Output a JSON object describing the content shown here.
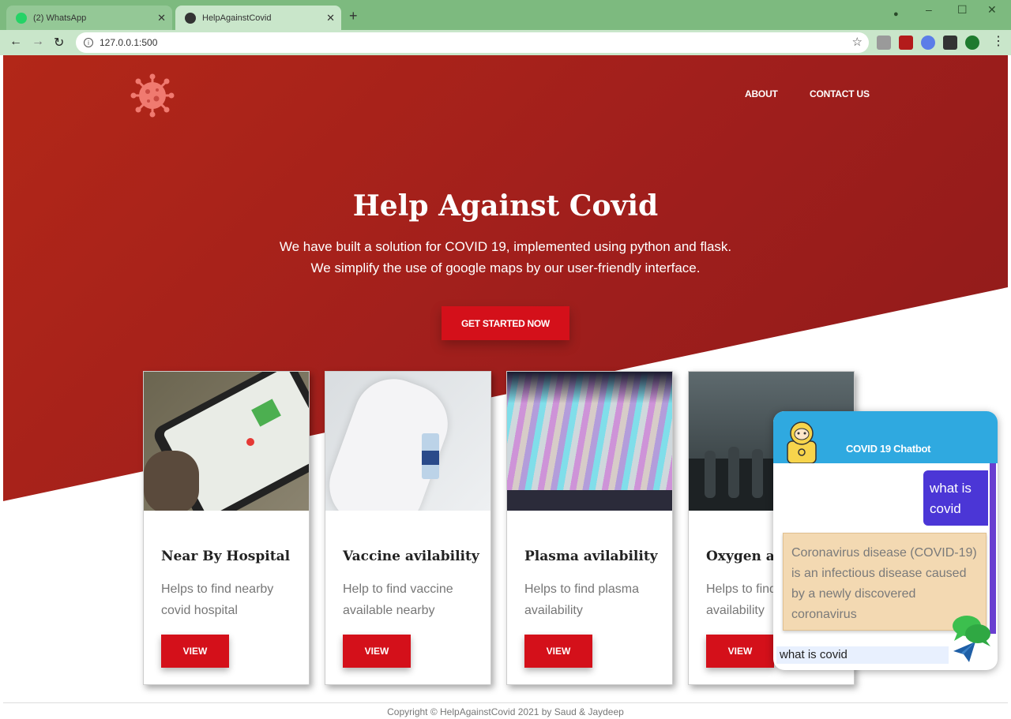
{
  "browser": {
    "tabs": [
      {
        "label": "(2) WhatsApp",
        "active": false
      },
      {
        "label": "HelpAgainstCovid",
        "active": true
      }
    ],
    "url": "127.0.0.1:500"
  },
  "nav": {
    "items": [
      "ABOUT",
      "CONTACT US"
    ]
  },
  "hero": {
    "title": "Help Against Covid",
    "line1": "We have built a solution for COVID 19, implemented using python and flask.",
    "line2": "We simplify the use of google maps by our user-friendly interface.",
    "cta": "GET STARTED NOW"
  },
  "cards": [
    {
      "title": "Near By Hospital",
      "desc": "Helps to find nearby covid hospital",
      "button": "VIEW",
      "image": "phone-map"
    },
    {
      "title": "Vaccine avilability",
      "desc": "Help to find vaccine available nearby",
      "button": "VIEW",
      "image": "vaccine-vial"
    },
    {
      "title": "Plasma avilability",
      "desc": "Helps to find plasma availability",
      "button": "VIEW",
      "image": "test-tubes"
    },
    {
      "title": "Oxygen avilability",
      "desc": "Helps to find oxygen availability",
      "button": "VIEW",
      "image": "oxygen-cylinders"
    }
  ],
  "chatbot": {
    "title": "COVID 19 Chatbot",
    "user_message": "what is covid",
    "bot_message": "Coronavirus disease (COVID-19) is an infectious disease caused by a newly discovered coronavirus",
    "input_value": "what is covid"
  },
  "footer": "Copyright © HelpAgainstCovid 2021 by Saud & Jaydeep",
  "colors": {
    "accent": "#d4101a",
    "chatbot_header": "#2fa9e0",
    "user_bubble": "#4b36d6",
    "bot_bubble": "#f3d9b2"
  }
}
